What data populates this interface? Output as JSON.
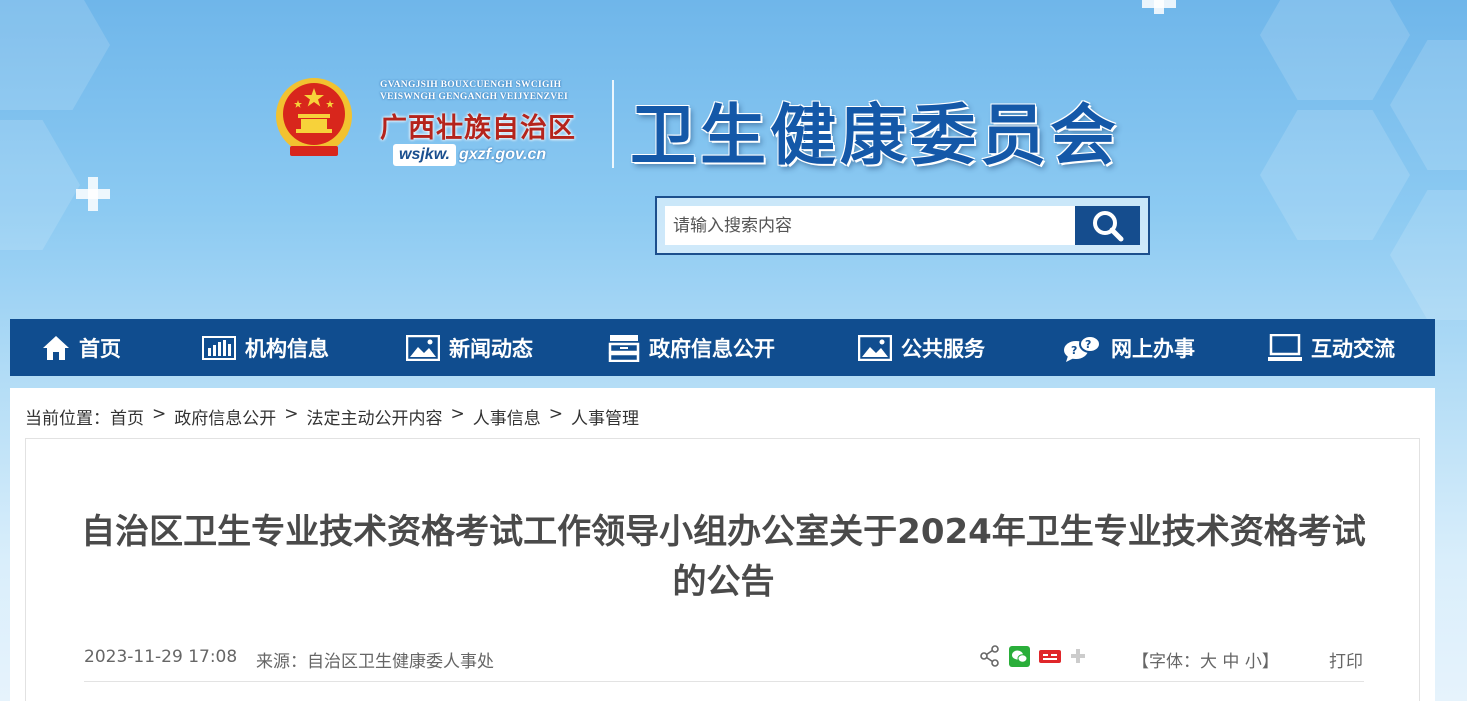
{
  "header": {
    "region_en_line1": "GVANGJSIH BOUXCUENGH SWCIGIH",
    "region_en_line2": "VEISWNGH GENGANGH VEIJYENZVEI",
    "region_cn": "广西壮族自治区",
    "domain_prefix": "wsjkw.",
    "domain_suffix": "gxzf.gov.cn",
    "site_title": "卫生健康委员会"
  },
  "search": {
    "placeholder": "请输入搜索内容",
    "icon": "search-icon"
  },
  "nav": {
    "items": [
      {
        "label": "首页",
        "icon": "home-icon"
      },
      {
        "label": "机构信息",
        "icon": "bar-chart-icon"
      },
      {
        "label": "新闻动态",
        "icon": "picture-icon"
      },
      {
        "label": "政府信息公开",
        "icon": "cabinet-icon"
      },
      {
        "label": "公共服务",
        "icon": "picture-icon"
      },
      {
        "label": "网上办事",
        "icon": "chat-icon"
      },
      {
        "label": "互动交流",
        "icon": "monitor-icon"
      }
    ]
  },
  "breadcrumb": {
    "prefix": "当前位置：",
    "items": [
      "首页",
      "政府信息公开",
      "法定主动公开内容",
      "人事信息",
      "人事管理"
    ],
    "separator": ">"
  },
  "article": {
    "title": "自治区卫生专业技术资格考试工作领导小组办公室关于2024年卫生专业技术资格考试的公告",
    "date": "2023-11-29 17:08",
    "source_label": "来源：",
    "source": "自治区卫生健康委人事处",
    "font_label_open": "【字体：",
    "font_large": "大",
    "font_medium": "中",
    "font_small": "小",
    "font_label_close": "】",
    "print": "打印",
    "share_icons": [
      "share-icon",
      "wechat-icon",
      "weibo-icon",
      "plus-icon"
    ]
  },
  "colors": {
    "nav_bg": "#104d8f",
    "title_blue": "#1458a8",
    "region_red": "#b5241c"
  }
}
